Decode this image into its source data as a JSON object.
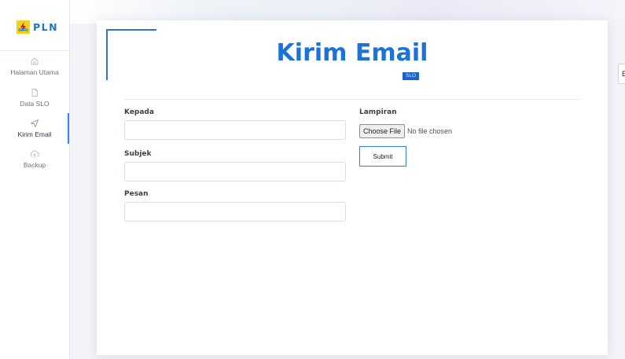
{
  "logo": {
    "text": "PLN",
    "icon": "lightning-icon"
  },
  "sidebar": {
    "items": [
      {
        "label": "Halaman Utama",
        "icon": "home-icon",
        "active": false
      },
      {
        "label": "Data SLO",
        "icon": "file-icon",
        "active": false
      },
      {
        "label": "Kirim Email",
        "icon": "send-icon",
        "active": true
      },
      {
        "label": "Backup",
        "icon": "cloud-upload-icon",
        "active": false
      }
    ]
  },
  "page": {
    "title": "Kirim Email",
    "badge": "SLO"
  },
  "form": {
    "to_label": "Kepada",
    "to_value": "",
    "subject_label": "Subjek",
    "subject_value": "",
    "message_label": "Pesan",
    "message_value": "",
    "attachment_label": "Lampiran",
    "file_button": "Choose File",
    "file_status": "No file chosen",
    "submit_label": "Submit"
  },
  "side_stub": {
    "label": "E"
  },
  "colors": {
    "accent": "#1b73d8",
    "active_indicator": "#3b82f6",
    "logo_yellow": "#f5d21a",
    "logo_blue": "#1a78bf"
  }
}
